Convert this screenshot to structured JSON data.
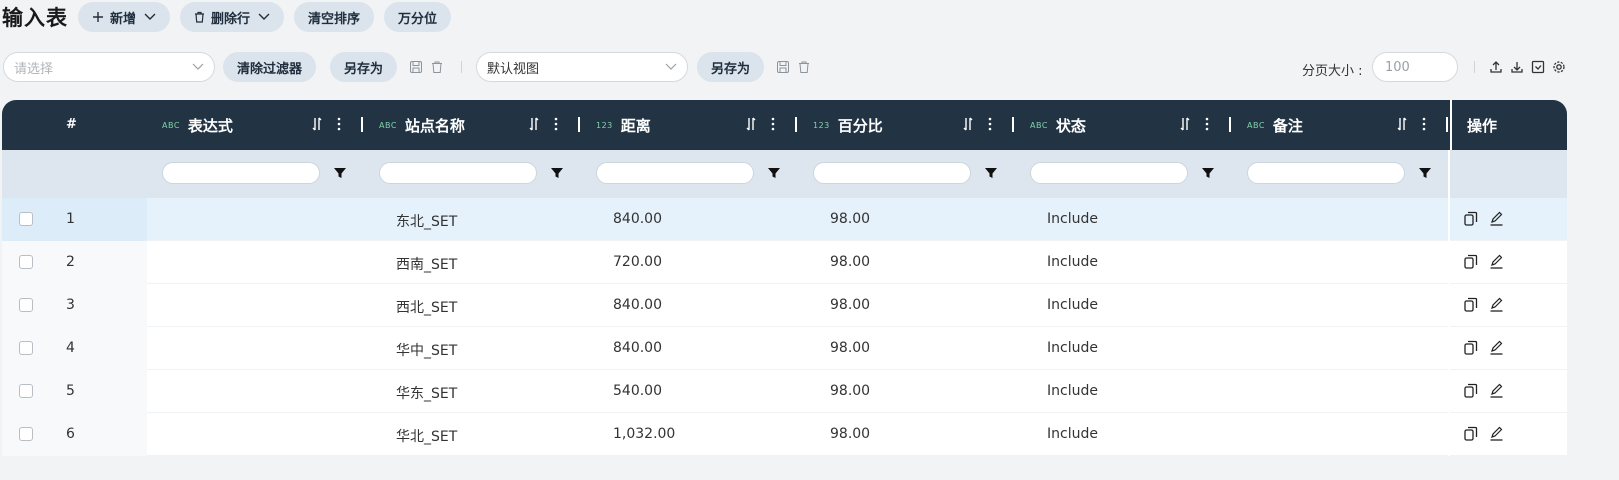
{
  "title": "输入表",
  "toolbar": {
    "add_label": "新增",
    "delete_label": "删除行",
    "clear_sort_label": "清空排序",
    "thousands_label": "万分位"
  },
  "filters": {
    "filter_select_placeholder": "请选择",
    "clear_filter_label": "清除过滤器",
    "save_as_label": "另存为",
    "view_select_value": "默认视图",
    "view_save_as_label": "另存为",
    "page_size_label": "分页大小 :",
    "page_size_value": "100"
  },
  "grid": {
    "row_number_header": "#",
    "columns": [
      {
        "type_tag": "ABC",
        "label": "表达式"
      },
      {
        "type_tag": "ABC",
        "label": "站点名称"
      },
      {
        "type_tag": "123",
        "label": "距离"
      },
      {
        "type_tag": "123",
        "label": "百分比"
      },
      {
        "type_tag": "ABC",
        "label": "状态"
      },
      {
        "type_tag": "ABC",
        "label": "备注"
      }
    ],
    "ops_header": "操作",
    "rows": [
      {
        "num": "1",
        "expr": "",
        "site": "东北_SET",
        "distance": "840.00",
        "percent": "98.00",
        "status": "Include",
        "note": ""
      },
      {
        "num": "2",
        "expr": "",
        "site": "西南_SET",
        "distance": "720.00",
        "percent": "98.00",
        "status": "Include",
        "note": ""
      },
      {
        "num": "3",
        "expr": "",
        "site": "西北_SET",
        "distance": "840.00",
        "percent": "98.00",
        "status": "Include",
        "note": ""
      },
      {
        "num": "4",
        "expr": "",
        "site": "华中_SET",
        "distance": "840.00",
        "percent": "98.00",
        "status": "Include",
        "note": ""
      },
      {
        "num": "5",
        "expr": "",
        "site": "华东_SET",
        "distance": "540.00",
        "percent": "98.00",
        "status": "Include",
        "note": ""
      },
      {
        "num": "6",
        "expr": "",
        "site": "华北_SET",
        "distance": "1,032.00",
        "percent": "98.00",
        "status": "Include",
        "note": ""
      }
    ]
  },
  "icons": [
    "plus-icon",
    "chevron-down-icon",
    "trash-icon",
    "save-icon",
    "upload-icon",
    "download-icon",
    "checkbox-icon",
    "gear-icon",
    "sort-icon",
    "more-icon",
    "filter-icon",
    "copy-icon",
    "edit-icon"
  ],
  "colors": {
    "header_bg": "#223344",
    "filter_row_bg": "#dde6ee",
    "active_row_bg": "#e5f1fb",
    "pill_bg": "#dbe4ec",
    "type_tag": "#7fd3a8"
  }
}
